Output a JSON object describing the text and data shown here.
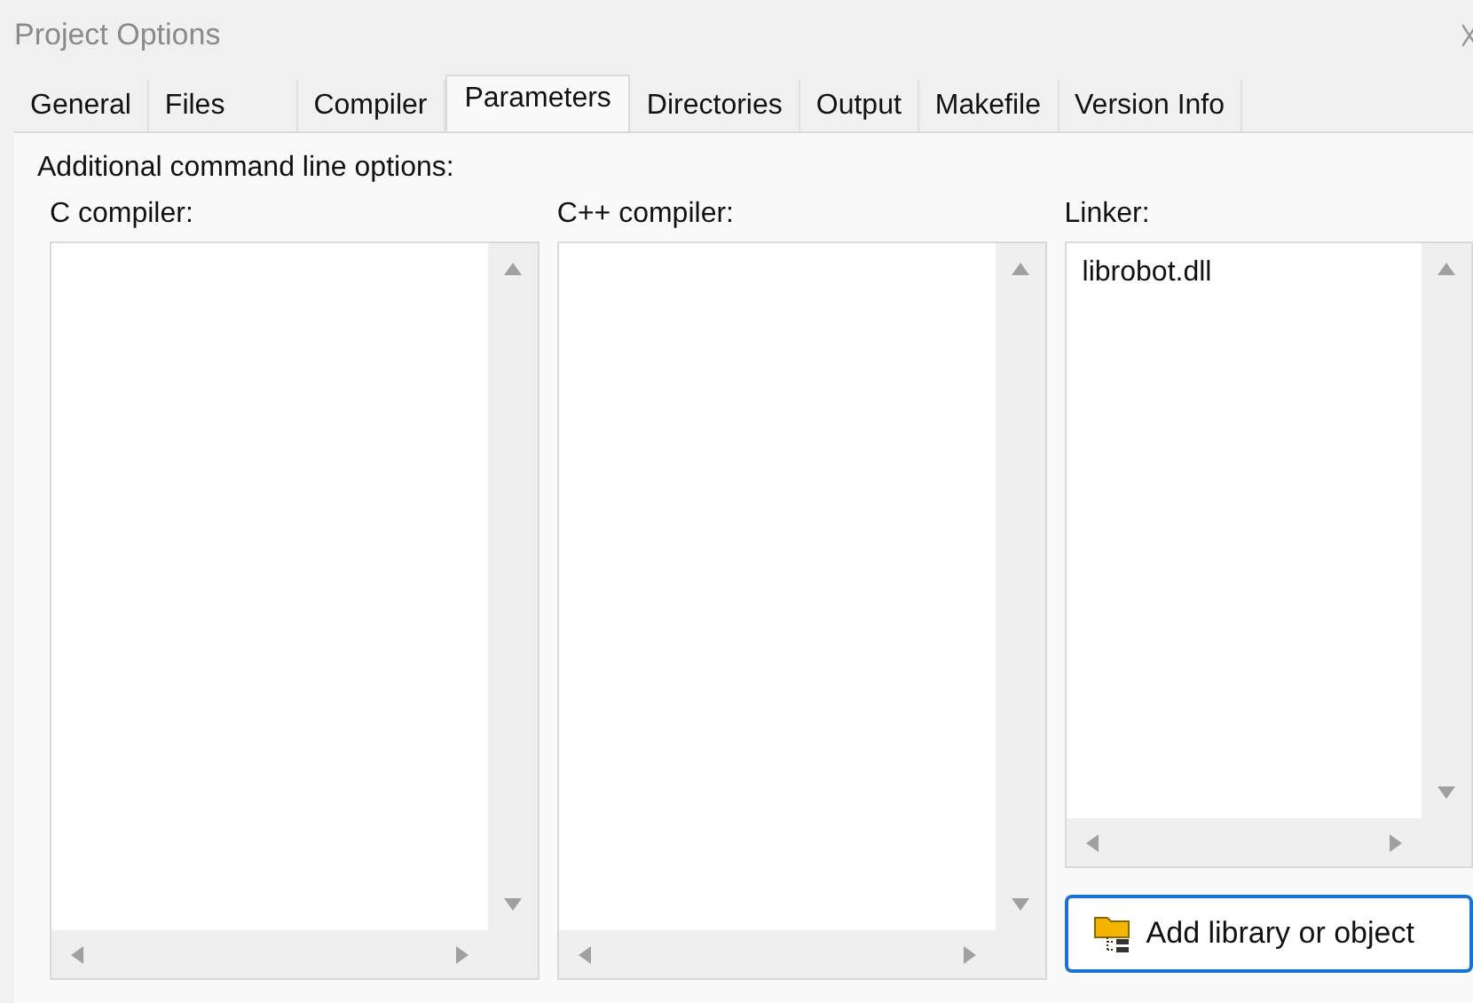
{
  "window": {
    "title": "Project Options"
  },
  "tabs": [
    {
      "label": "General",
      "selected": false
    },
    {
      "label": "Files",
      "selected": false
    },
    {
      "label": "Compiler",
      "selected": false
    },
    {
      "label": "Parameters",
      "selected": true
    },
    {
      "label": "Directories",
      "selected": false
    },
    {
      "label": "Output",
      "selected": false
    },
    {
      "label": "Makefile",
      "selected": false
    },
    {
      "label": "Version Info",
      "selected": false
    }
  ],
  "heading": "Additional command line options:",
  "fields": [
    {
      "label": "C compiler:"
    },
    {
      "label": "C++ compiler:"
    },
    {
      "label": "Linker:",
      "value": "librobot.dll"
    }
  ],
  "button": "Add library or object"
}
